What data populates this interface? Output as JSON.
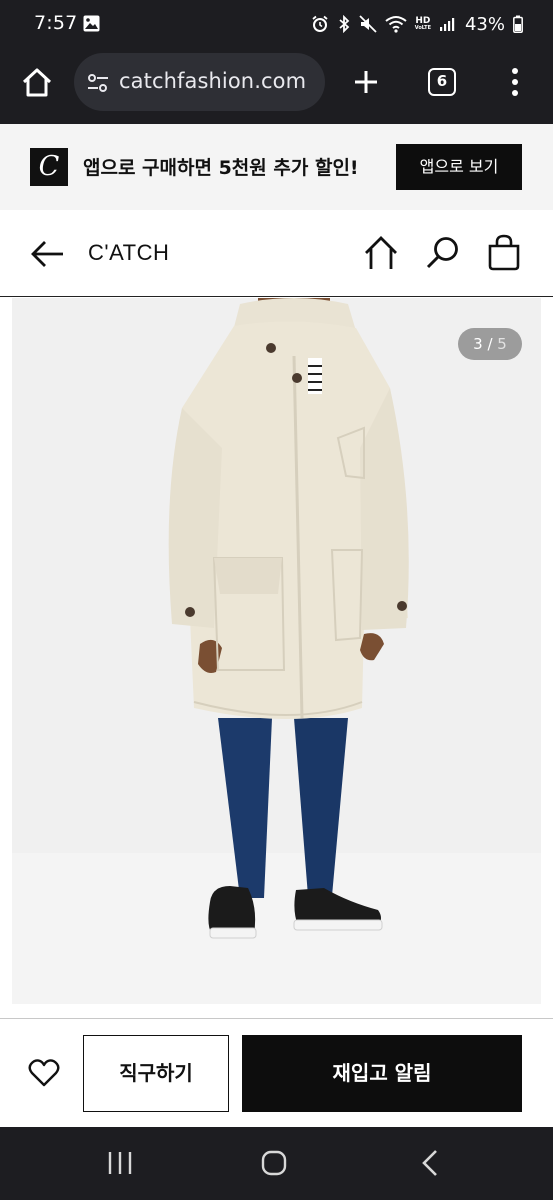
{
  "status_bar": {
    "time": "7:57",
    "battery": "43%",
    "network_label": "HD",
    "network_sub": "VoLTE",
    "icons": [
      "gallery-icon",
      "alarm-icon",
      "bluetooth-icon",
      "mute-icon",
      "wifi-icon",
      "hd-volte-icon",
      "signal-icon",
      "battery-icon"
    ]
  },
  "browser": {
    "url": "catchfashion.com",
    "tab_count": "6",
    "icons": [
      "home-icon",
      "site-settings-icon",
      "plus-icon",
      "more-vert-icon"
    ]
  },
  "app_banner": {
    "logo_letter": "C",
    "text": "앱으로 구매하면 5천원 추가 할인!",
    "button_label": "앱으로 보기"
  },
  "header": {
    "logo": "C'ATCH",
    "icons": [
      "back-arrow-icon",
      "home-icon",
      "search-icon",
      "shopping-bag-icon"
    ]
  },
  "gallery": {
    "current": "3",
    "separator": " / ",
    "total": "5"
  },
  "actions": {
    "buy_label": "직구하기",
    "notify_label": "재입고 알림",
    "icons": [
      "heart-icon"
    ]
  },
  "nav_bar": {
    "icons": [
      "recent-apps-icon",
      "home-circle-icon",
      "back-chevron-icon"
    ]
  },
  "colors": {
    "system_bar": "#1d1d21",
    "url_pill": "#2e2f35",
    "banner_bg": "#f4f4f4",
    "primary_button": "#0d0d0d",
    "counter_bg": "#9c9c9c",
    "coat": "#ece6d6",
    "jeans": "#1c3a6b"
  }
}
